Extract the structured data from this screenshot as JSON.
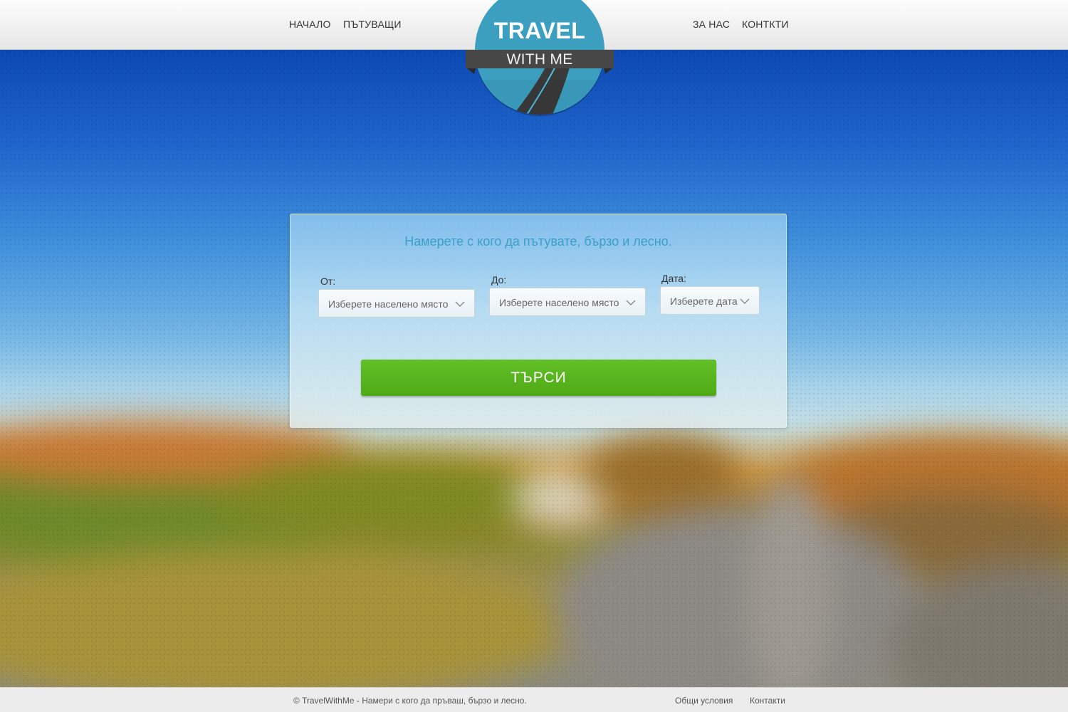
{
  "header": {
    "nav_left": [
      {
        "label": "НАЧАЛО"
      },
      {
        "label": "ПЪТУВАЩИ"
      }
    ],
    "nav_right": [
      {
        "label": "ЗА НАС"
      },
      {
        "label": "КОНТКТИ"
      }
    ]
  },
  "logo": {
    "title": "TRAVEL",
    "subtitle": "WITH ME",
    "colors": {
      "circle": "#3c9fc0",
      "ribbon": "#444444",
      "road": "#3a3a3a",
      "road_line": "#4cc0e0"
    }
  },
  "search": {
    "title": "Намерете с кого да пътувате, бързо и лесно.",
    "from": {
      "label": "От:",
      "value": "Изберете населено място",
      "icon": "chevron-down-icon"
    },
    "to": {
      "label": "До:",
      "value": "Изберете населено място",
      "icon": "chevron-down-icon"
    },
    "date": {
      "label": "Дата:",
      "value": "Изберете дата",
      "icon": "chevron-down-icon"
    },
    "button_label": "ТЪРСИ",
    "colors": {
      "title": "#3a9fc7",
      "button": "#58b51e"
    }
  },
  "footer": {
    "copyright": "© TravelWithMe - Намери с кого да пръваш, бързо и лесно.",
    "links": [
      {
        "label": "Общи условия"
      },
      {
        "label": "Контакти"
      }
    ]
  }
}
